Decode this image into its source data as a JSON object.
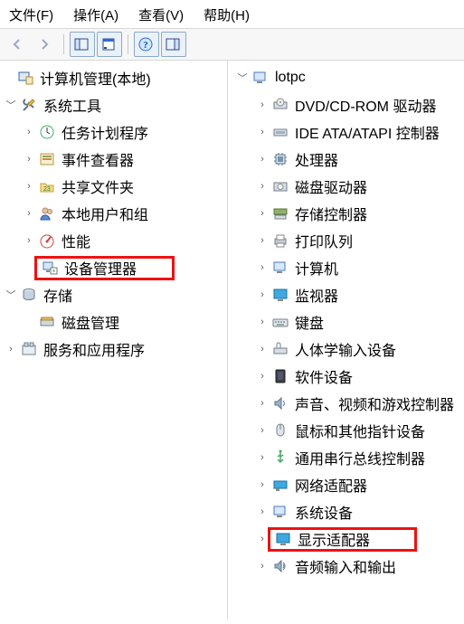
{
  "menu": {
    "file": "文件(F)",
    "action": "操作(A)",
    "view": "查看(V)",
    "help": "帮助(H)"
  },
  "toolbar": {
    "back": "back-icon",
    "forward": "forward-icon",
    "show_hide": "panel-icon",
    "properties": "properties-icon",
    "help": "help-icon",
    "extra": "extra-panel-icon"
  },
  "left": {
    "root": "计算机管理(本地)",
    "system_tools": "系统工具",
    "task_scheduler": "任务计划程序",
    "event_viewer": "事件查看器",
    "shared_folders": "共享文件夹",
    "local_users": "本地用户和组",
    "performance": "性能",
    "device_manager": "设备管理器",
    "storage": "存储",
    "disk_management": "磁盘管理",
    "services_apps": "服务和应用程序"
  },
  "right": {
    "root": "lotpc",
    "dvd": "DVD/CD-ROM 驱动器",
    "ide": "IDE ATA/ATAPI 控制器",
    "processors": "处理器",
    "disk_drives": "磁盘驱动器",
    "storage_controllers": "存储控制器",
    "print_queues": "打印队列",
    "computer": "计算机",
    "monitors": "监视器",
    "keyboards": "键盘",
    "hid": "人体学输入设备",
    "software_devices": "软件设备",
    "audio_video_game": "声音、视频和游戏控制器",
    "mice": "鼠标和其他指针设备",
    "usb": "通用串行总线控制器",
    "network_adapters": "网络适配器",
    "system_devices": "系统设备",
    "display_adapters": "显示适配器",
    "audio_io": "音频输入和输出"
  },
  "colors": {
    "highlight": "#e11",
    "arrow": "#5a5a5a"
  }
}
